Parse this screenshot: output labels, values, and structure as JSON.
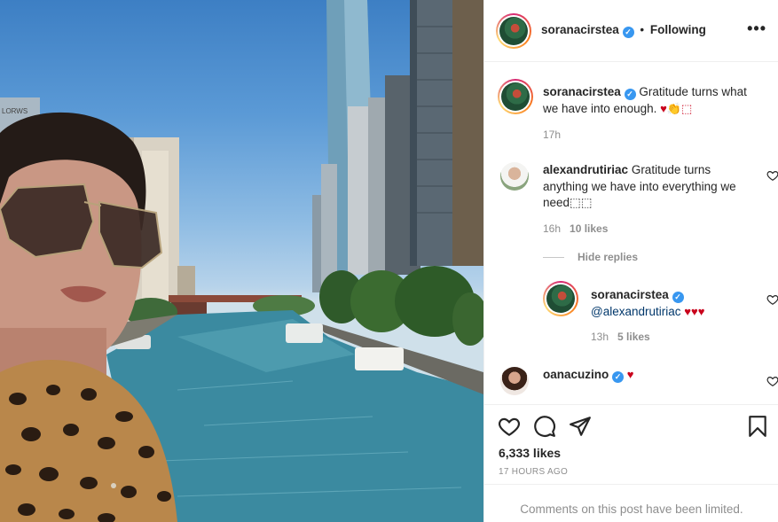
{
  "post": {
    "author": "soranacirstea",
    "separator": "•",
    "follow_status": "Following",
    "more_label": "•••"
  },
  "caption": {
    "username": "soranacirstea",
    "text": "Gratitude turns what we have into enough.",
    "emoji_suffix": "♥👏⬚",
    "time": "17h"
  },
  "comments": [
    {
      "username": "alexandrutiriac",
      "text": "Gratitude turns anything we have into everything we need",
      "emoji_suffix": "⬚⬚",
      "time": "16h",
      "likes": "10 likes"
    }
  ],
  "hide_replies_label": "Hide replies",
  "reply": {
    "username": "soranacirstea",
    "mention": "@alexandrutiriac",
    "hearts": "♥♥♥",
    "time": "13h",
    "likes": "5 likes"
  },
  "comment2": {
    "username": "oanacuzino",
    "hearts": "♥"
  },
  "stats": {
    "likes": "6,333 likes",
    "posted": "17 HOURS AGO"
  },
  "footer": {
    "limited_text": "Comments on this post have been limited."
  },
  "photo_text": {
    "building_sign": "LORWS"
  },
  "colors": {
    "accent": "#3897f0",
    "heart": "#c9001b",
    "muted": "#8e8e8e",
    "text": "#262626"
  },
  "icons": [
    "verified-badge-icon",
    "more-options-icon",
    "heart-icon",
    "comment-icon",
    "share-icon",
    "bookmark-icon"
  ]
}
